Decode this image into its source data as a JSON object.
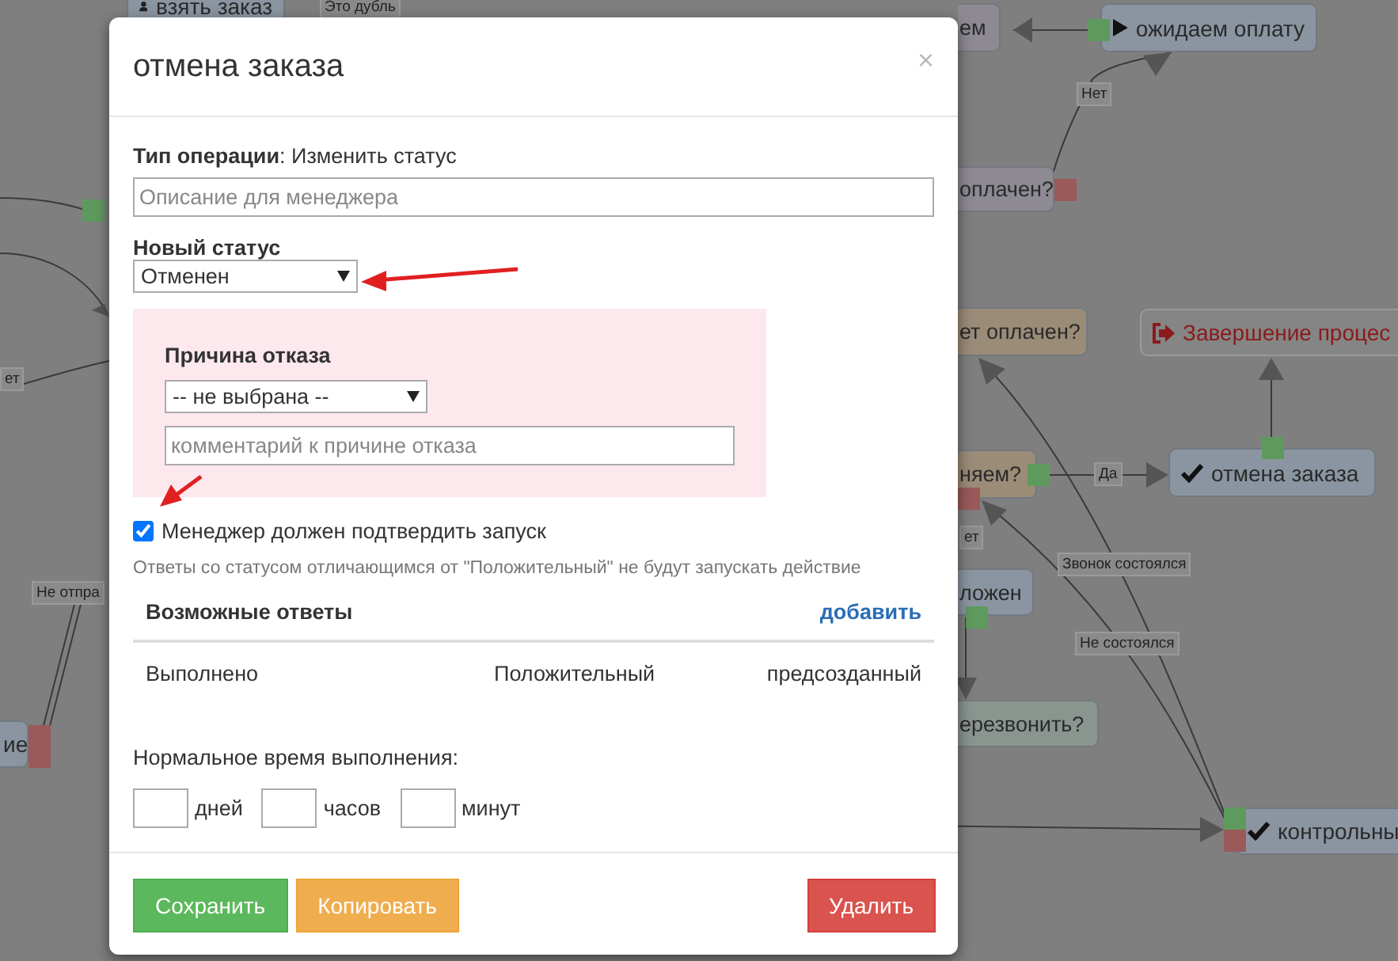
{
  "diagram": {
    "nodes": [
      {
        "text": "взять заказ",
        "kind": "action"
      },
      {
        "text": "ем",
        "kind": "plain"
      },
      {
        "text": "ожидаем оплату",
        "kind": "action"
      },
      {
        "text": "оплачен?",
        "kind": "plain"
      },
      {
        "text": "ет оплачен?",
        "kind": "question"
      },
      {
        "text": "Завершение процес",
        "kind": "end"
      },
      {
        "text": "няем?",
        "kind": "question"
      },
      {
        "text": "отмена заказа",
        "kind": "action"
      },
      {
        "text": "ложен",
        "kind": "action"
      },
      {
        "text": "ерезвонить?",
        "kind": "muted"
      },
      {
        "text": "контрольны",
        "kind": "action"
      },
      {
        "text": "ие",
        "kind": "action"
      }
    ],
    "edge_labels": [
      "Это дубль",
      "Нет",
      "Да",
      "ет",
      "Звонок состоялся",
      "Не состоялся",
      "ет",
      "Не отпра"
    ],
    "ports": [
      {
        "color": "#5e9a5e"
      },
      {
        "color": "#9a5a5a"
      },
      {
        "color": "#5e9a5e"
      },
      {
        "color": "#5e9a5e"
      },
      {
        "color": "#9a5a5a"
      },
      {
        "color": "#5e9a5e"
      },
      {
        "color": "#5e9a5e"
      },
      {
        "color": "#9a5a5a"
      },
      {
        "color": "#9a5a5a"
      },
      {
        "color": "#9a5a5a"
      },
      {
        "color": "#5e9a5e"
      }
    ]
  },
  "modal": {
    "title": "отмена заказа",
    "close": "×",
    "operation": "**Тип операции**: Изменить статус",
    "description": {
      "placeholder": "Описание для менеджера"
    },
    "status": {
      "label": "Новый статус",
      "value": "Отменен"
    },
    "reason": {
      "label": "Причина отказа",
      "value": "-- не выбрана --",
      "comment": {
        "placeholder": "комментарий к причине отказа"
      }
    },
    "confirm": {
      "label": "Менеджер должен подтвердить запуск",
      "checked": true
    },
    "hint": "Ответы со статусом отличающимся от \"Положительный\" не будут запускать действие",
    "answers": {
      "title": "Возможные ответы",
      "add": "добавить",
      "rows": [
        {
          "name": "Выполнено",
          "status": "Положительный",
          "type": "предсозданный"
        }
      ]
    },
    "time": {
      "label": "Нормальное время выполнения:",
      "units": [
        "дней",
        "часов",
        "минут"
      ]
    },
    "buttons": [
      {
        "label": "Сохранить",
        "kind": "success"
      },
      {
        "label": "Копировать",
        "kind": "warning"
      },
      {
        "label": "Удалить",
        "kind": "danger"
      }
    ]
  }
}
